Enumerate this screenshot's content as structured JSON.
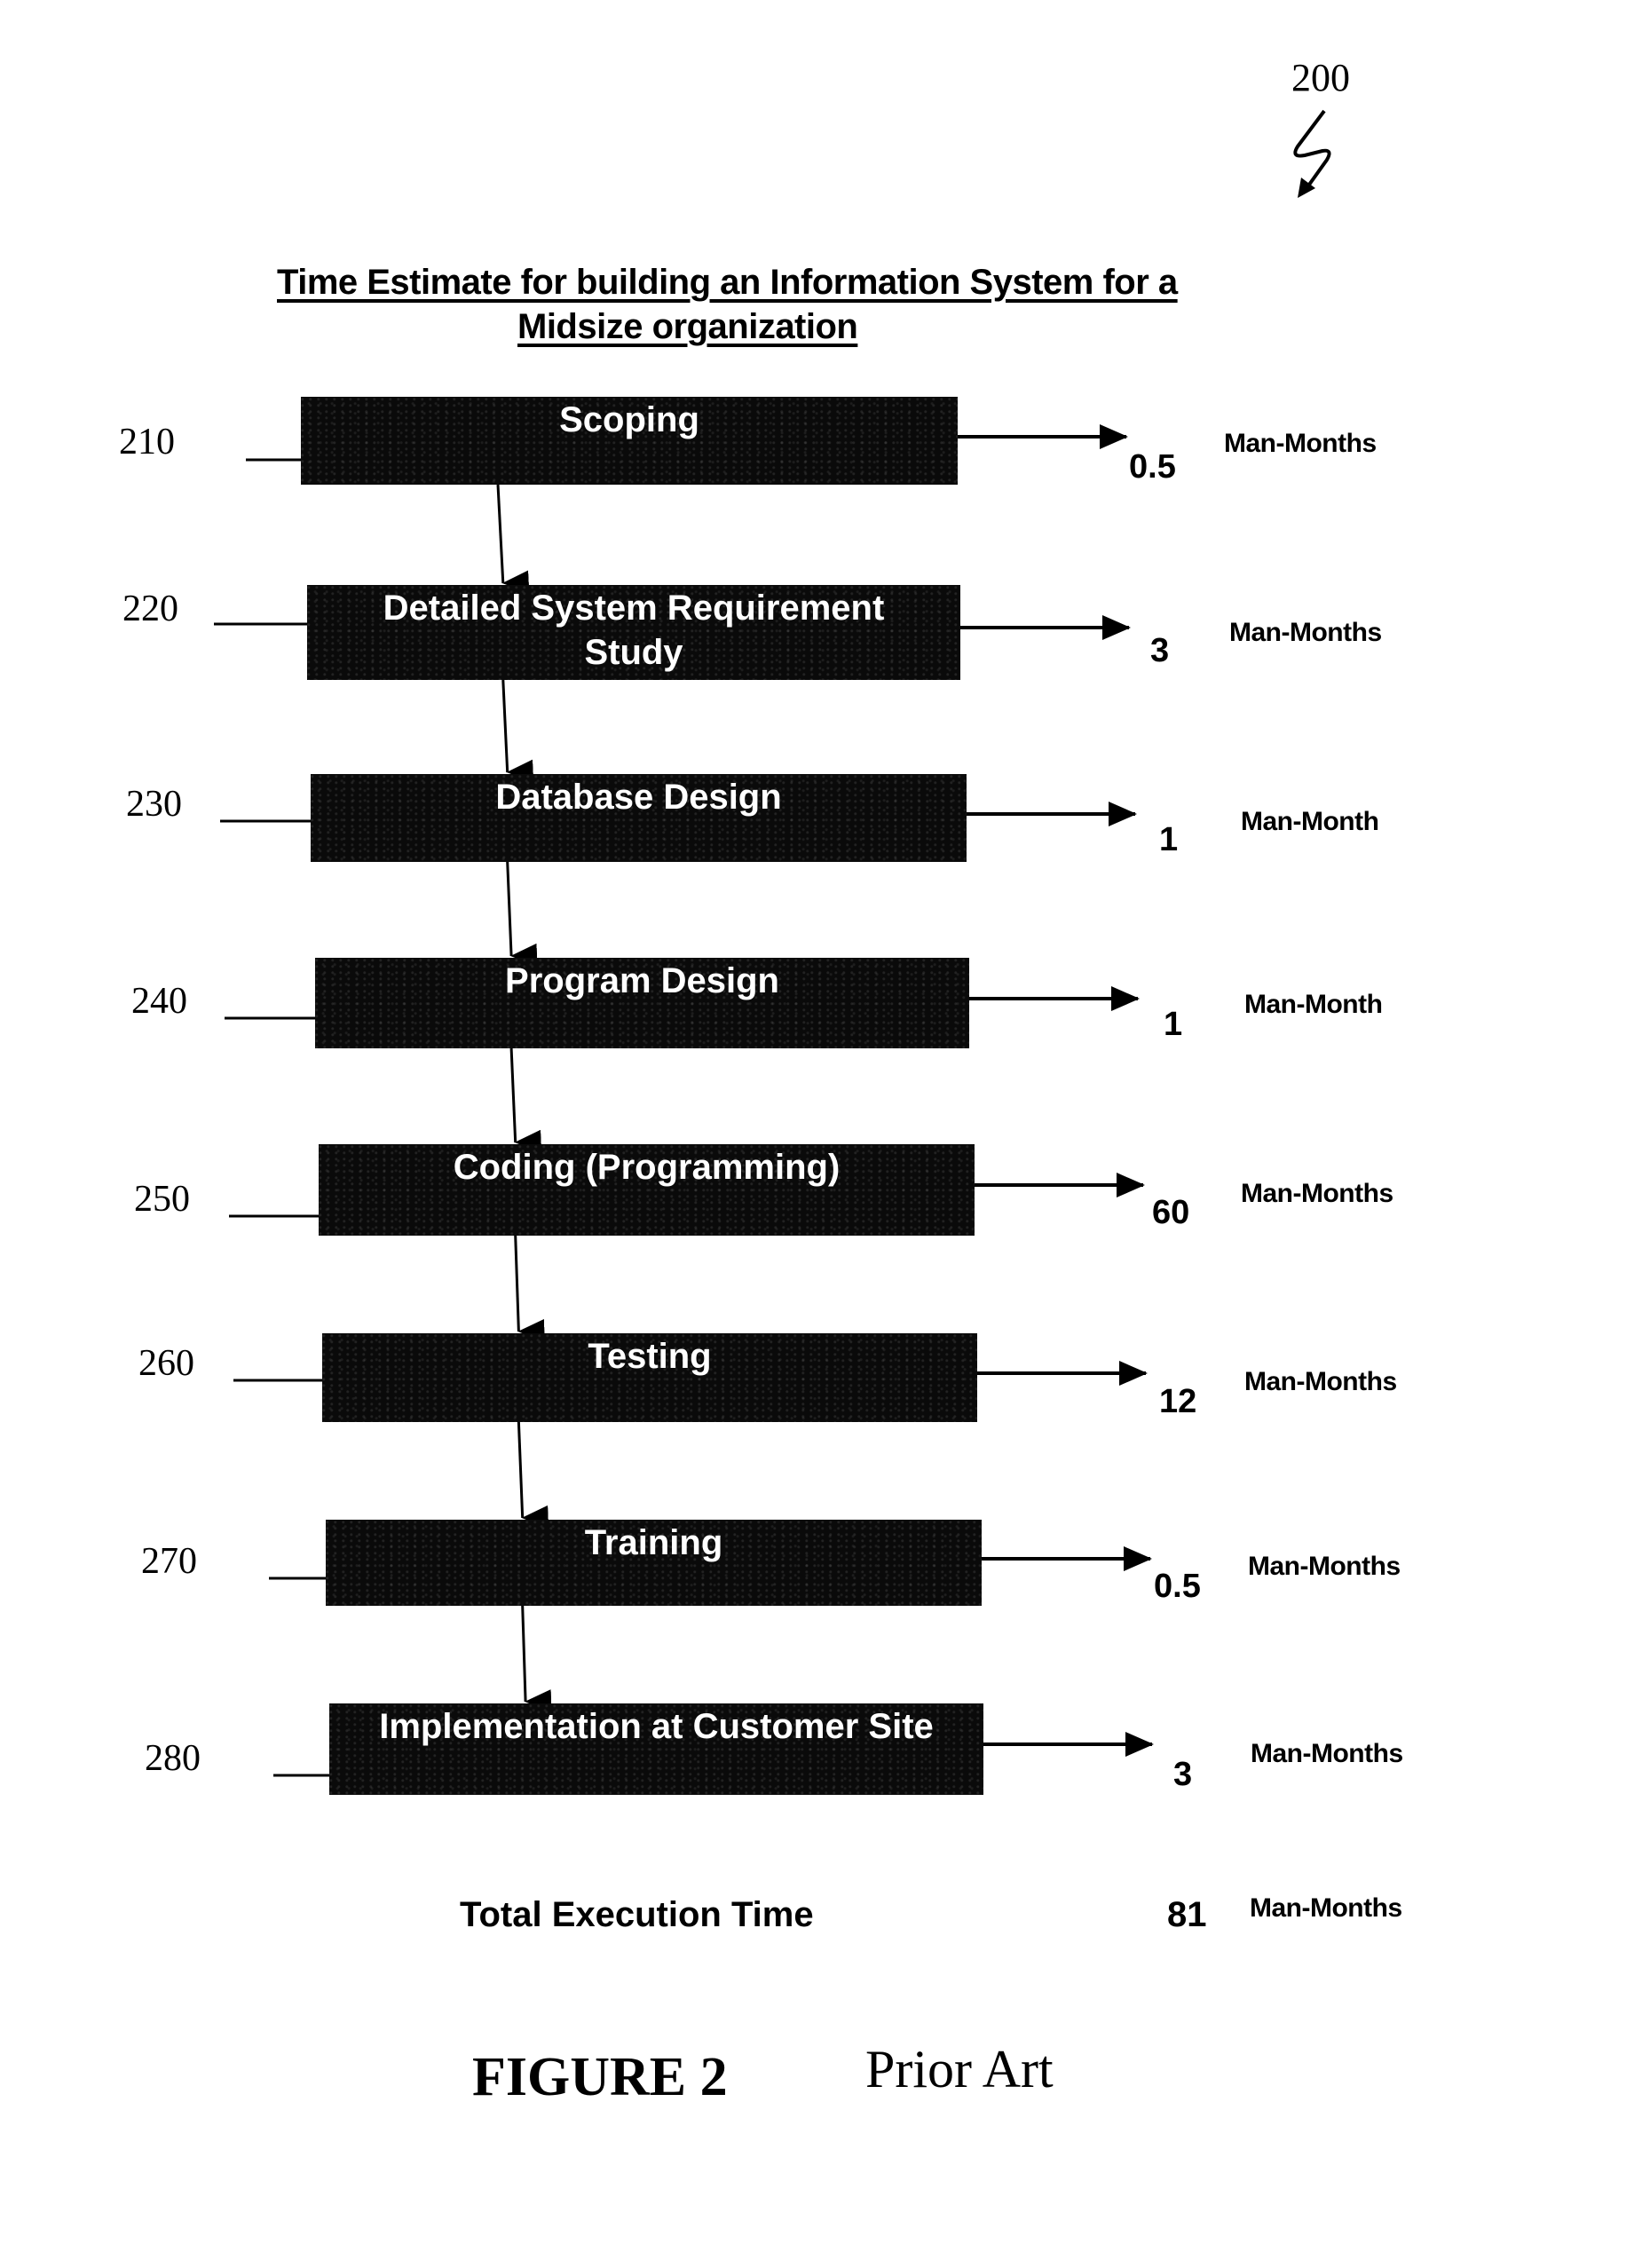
{
  "figure_ref": "200",
  "title": {
    "line1": "Time Estimate for building an Information System for a",
    "line2": "Midsize organization"
  },
  "steps": [
    {
      "ref": "210",
      "label_lines": [
        "Scoping"
      ],
      "value": "0.5",
      "unit": "Man-Months"
    },
    {
      "ref": "220",
      "label_lines": [
        "Detailed System Requirement",
        "Study"
      ],
      "value": "3",
      "unit": "Man-Months"
    },
    {
      "ref": "230",
      "label_lines": [
        "Database Design"
      ],
      "value": "1",
      "unit": "Man-Month"
    },
    {
      "ref": "240",
      "label_lines": [
        "Program Design"
      ],
      "value": "1",
      "unit": "Man-Month"
    },
    {
      "ref": "250",
      "label_lines": [
        "Coding (Programming)"
      ],
      "value": "60",
      "unit": "Man-Months"
    },
    {
      "ref": "260",
      "label_lines": [
        "Testing"
      ],
      "value": "12",
      "unit": "Man-Months"
    },
    {
      "ref": "270",
      "label_lines": [
        "Training"
      ],
      "value": "0.5",
      "unit": "Man-Months"
    },
    {
      "ref": "280",
      "label_lines": [
        "Implementation at Customer Site"
      ],
      "value": "3",
      "unit": "Man-Months"
    }
  ],
  "total": {
    "label": "Total Execution Time",
    "value": "81",
    "unit": "Man-Months"
  },
  "caption": {
    "figure": "FIGURE 2",
    "note": "Prior Art"
  }
}
